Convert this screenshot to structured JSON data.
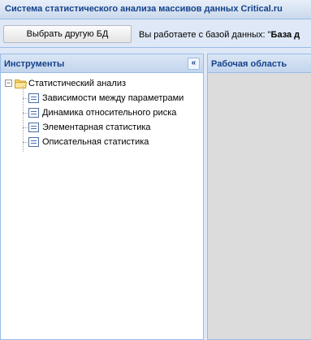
{
  "app": {
    "title": "Система статистического анализа массивов данных Critical.ru"
  },
  "toolbar": {
    "change_db_button": "Выбрать другую БД",
    "info_prefix": "Вы работаете с базой данных: \"",
    "info_db_name": "База д"
  },
  "tools_panel": {
    "title": "Инструменты",
    "collapse_icon": "double-chevron-left-icon",
    "tree": {
      "root": {
        "label": "Статистический анализ",
        "expanded": true
      },
      "items": [
        {
          "label": "Зависимости между параметрами"
        },
        {
          "label": "Динамика относительного риска"
        },
        {
          "label": "Элементарная статистика"
        },
        {
          "label": "Описательная статистика"
        }
      ]
    }
  },
  "work_panel": {
    "title": "Рабочая область"
  },
  "colors": {
    "header_text": "#15428b",
    "border": "#99bbe8",
    "background": "#dfe8f6"
  }
}
